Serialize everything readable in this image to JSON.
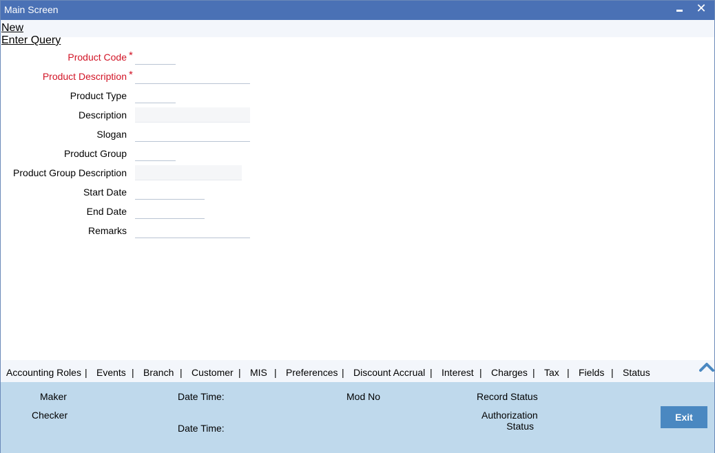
{
  "titlebar": {
    "title": "Main Screen",
    "minimize_icon": "minimize-icon",
    "close_icon": "close-icon",
    "close_glyph": "✕"
  },
  "menu": {
    "new": "New",
    "enter_query": "Enter Query"
  },
  "form": {
    "product_code": {
      "label": "Product Code",
      "required": true,
      "value": ""
    },
    "product_description": {
      "label": "Product Description",
      "required": true,
      "value": ""
    },
    "product_type": {
      "label": "Product Type",
      "value": ""
    },
    "description": {
      "label": "Description",
      "value": ""
    },
    "slogan": {
      "label": "Slogan",
      "value": ""
    },
    "product_group": {
      "label": "Product Group",
      "value": ""
    },
    "product_group_description": {
      "label": "Product Group Description",
      "value": ""
    },
    "start_date": {
      "label": "Start Date",
      "value": ""
    },
    "end_date": {
      "label": "End Date",
      "value": ""
    },
    "remarks": {
      "label": "Remarks",
      "value": ""
    },
    "required_marker": "*"
  },
  "tabs": {
    "items": [
      "Accounting Roles",
      "Events",
      "Branch",
      "Customer",
      "MIS",
      "Preferences",
      "Discount Accrual",
      "Interest",
      "Charges",
      "Tax",
      "Fields",
      "Status"
    ],
    "separator": "|",
    "collapse_icon": "chevron-up-icon"
  },
  "footer": {
    "maker": "Maker",
    "checker": "Checker",
    "date_time_1": "Date Time:",
    "date_time_2": "Date Time:",
    "mod_no": "Mod No",
    "record_status": "Record Status",
    "authorization_status_line1": "Authorization",
    "authorization_status_line2": "Status",
    "exit_label": "Exit"
  },
  "colors": {
    "titlebar": "#4a71b5",
    "required": "#d21426",
    "footer": "#bfd9ec",
    "exit_button": "#4a88c1"
  }
}
